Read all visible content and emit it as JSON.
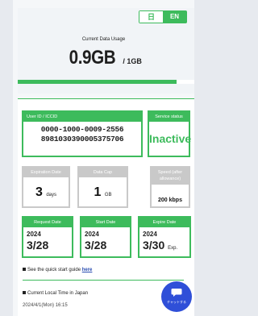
{
  "lang": {
    "ja": "日",
    "en": "EN",
    "selected": "EN"
  },
  "usage": {
    "label": "Current Data Usage",
    "value": "0.9GB",
    "cap": "/ 1GB",
    "progress_percent": 90
  },
  "sim": {
    "iccid_label": "User ID / ICCID",
    "iccid_line1": "0000-1000-0009-2556",
    "iccid_line2": "8981030390005375706",
    "status_label": "Service status",
    "status_value": "Inactive"
  },
  "specs": {
    "expiration_label": "Expiration Date",
    "expiration_value": "3",
    "expiration_unit": "days",
    "datacap_label": "Data Cap",
    "datacap_value": "1",
    "datacap_unit": "GB",
    "speed_label": "Speed (after allowance)",
    "speed_value": "200 kbps"
  },
  "dates": {
    "request_label": "Request Date",
    "request_year": "2024",
    "request_md": "3/28",
    "start_label": "Start Date",
    "start_year": "2024",
    "start_md": "3/28",
    "expire_label": "Expire Date",
    "expire_year": "2024",
    "expire_md": "3/30",
    "expire_suffix": "Exp."
  },
  "guide": {
    "text": "See the quick start guide ",
    "link": "here"
  },
  "local_time": {
    "label": "Current Local Time in Japan",
    "value": "2024/4/1(Mon) 16:15"
  },
  "chat": {
    "label": "チャットする"
  },
  "colors": {
    "accent": "#3dbb5c",
    "gray": "#c9c9c9",
    "link": "#2a4db1",
    "chat": "#2f4fd8"
  }
}
